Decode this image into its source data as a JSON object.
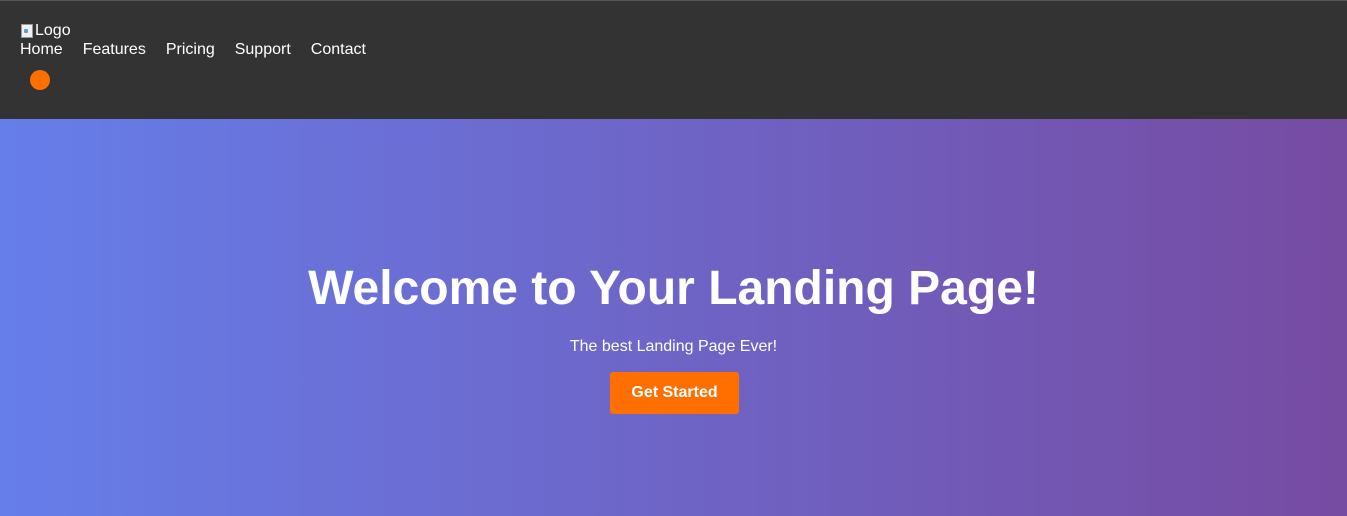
{
  "header": {
    "logo_alt": "Logo",
    "nav_items": [
      {
        "label": "Home"
      },
      {
        "label": "Features"
      },
      {
        "label": "Pricing"
      },
      {
        "label": "Support"
      },
      {
        "label": "Contact"
      }
    ]
  },
  "hero": {
    "title": "Welcome to Your Landing Page!",
    "subtitle": "The best Landing Page Ever!",
    "cta_label": "Get Started"
  },
  "colors": {
    "header_bg": "#333333",
    "accent": "#ff6f00",
    "gradient_start": "#667eea",
    "gradient_end": "#764ba2"
  }
}
